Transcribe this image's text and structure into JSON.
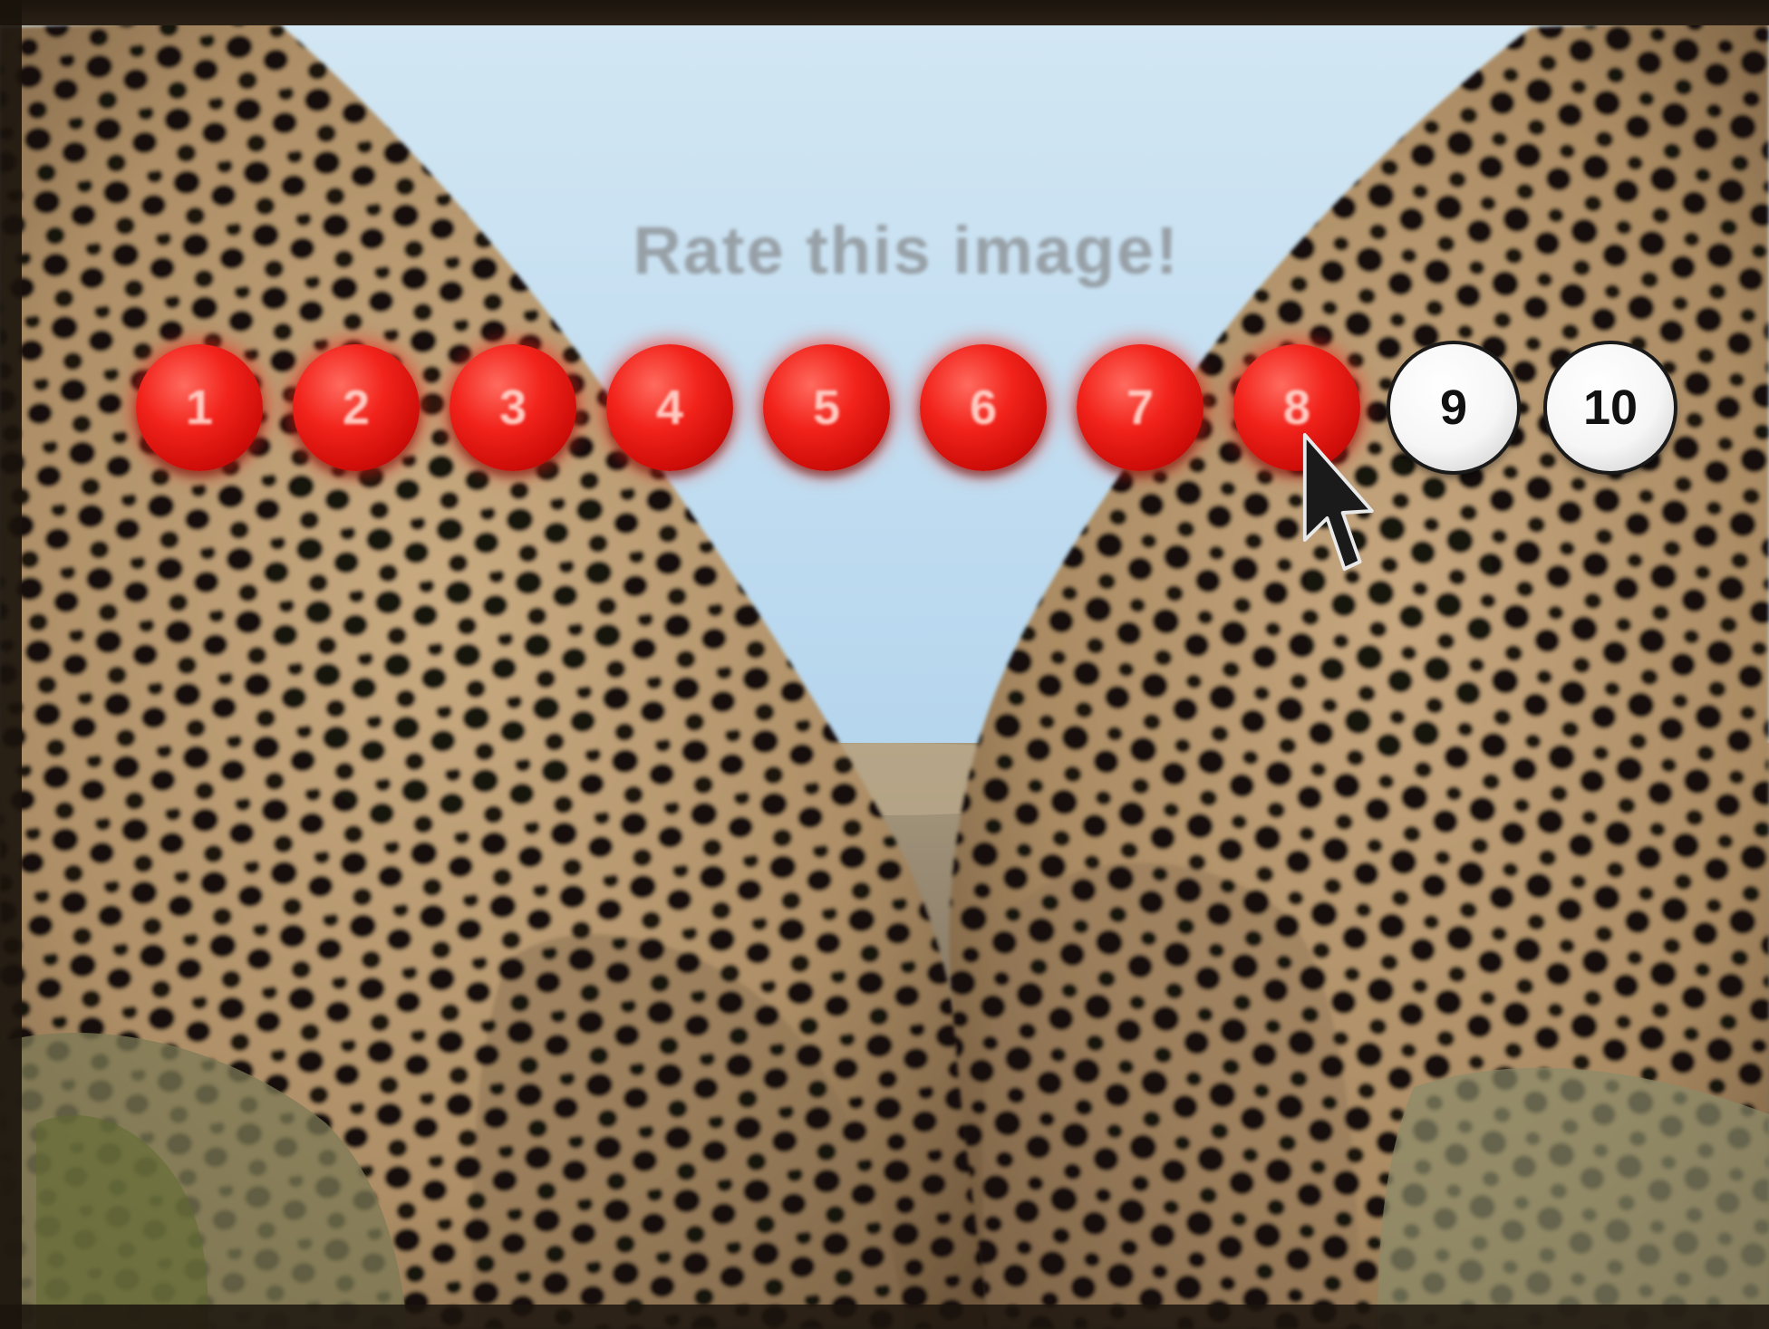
{
  "prompt": {
    "text": "Rate this image!"
  },
  "rating": {
    "scale_max": 10,
    "selected_value": 8,
    "colors": {
      "selected": "#e8231b",
      "unselected": "#ffffff"
    },
    "items": [
      {
        "label": "1",
        "value": 1,
        "selected": true
      },
      {
        "label": "2",
        "value": 2,
        "selected": true
      },
      {
        "label": "3",
        "value": 3,
        "selected": true
      },
      {
        "label": "4",
        "value": 4,
        "selected": true
      },
      {
        "label": "5",
        "value": 5,
        "selected": true
      },
      {
        "label": "6",
        "value": 6,
        "selected": true
      },
      {
        "label": "7",
        "value": 7,
        "selected": true
      },
      {
        "label": "8",
        "value": 8,
        "selected": true
      },
      {
        "label": "9",
        "value": 9,
        "selected": false
      },
      {
        "label": "10",
        "value": 10,
        "selected": false
      }
    ]
  },
  "background": {
    "subject": "two cheetahs",
    "sky_color": "#bcdcf0",
    "fur_color": "#b89870",
    "spot_color": "#0e0a06"
  },
  "cursor": {
    "icon": "arrow-cursor-icon",
    "hover_value": 8
  }
}
